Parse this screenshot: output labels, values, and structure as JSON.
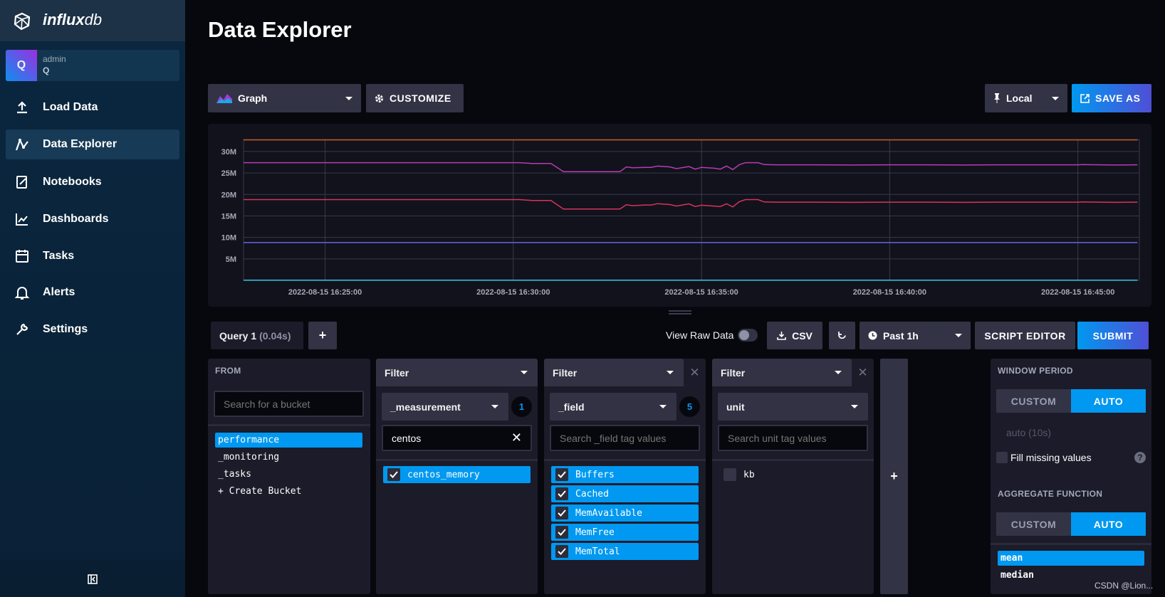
{
  "app": {
    "logo_main": "influx",
    "logo_sub": "db"
  },
  "user": {
    "avatar_letter": "Q",
    "role": "admin",
    "org": "Q"
  },
  "sidebar": {
    "items": [
      {
        "label": "Load Data",
        "icon": "upload-icon"
      },
      {
        "label": "Data Explorer",
        "icon": "graph-icon",
        "active": true
      },
      {
        "label": "Notebooks",
        "icon": "notebook-icon"
      },
      {
        "label": "Dashboards",
        "icon": "dashboard-icon"
      },
      {
        "label": "Tasks",
        "icon": "calendar-icon"
      },
      {
        "label": "Alerts",
        "icon": "bell-icon"
      },
      {
        "label": "Settings",
        "icon": "wrench-icon"
      }
    ]
  },
  "header": {
    "title": "Data Explorer"
  },
  "toolbar": {
    "vis_type": "Graph",
    "customize": "CUSTOMIZE",
    "time_zone": "Local",
    "save_as": "SAVE AS"
  },
  "query_bar": {
    "tab_label": "Query 1",
    "tab_time": "(0.04s)",
    "add": "+",
    "view_raw": "View Raw Data",
    "view_raw_on": false,
    "csv": "CSV",
    "time_range": "Past 1h",
    "script_editor": "SCRIPT EDITOR",
    "submit": "SUBMIT"
  },
  "from": {
    "label": "FROM",
    "search_placeholder": "Search for a bucket",
    "buckets": [
      "performance",
      "_monitoring",
      "_tasks"
    ],
    "selected": "performance",
    "create": "+ Create Bucket"
  },
  "filters": [
    {
      "header": "Filter",
      "key": "_measurement",
      "count": "1",
      "search_value": "centos",
      "search_placeholder": "",
      "values": [
        {
          "label": "centos_memory",
          "checked": true
        }
      ]
    },
    {
      "header": "Filter",
      "key": "_field",
      "count": "5",
      "search_value": "",
      "search_placeholder": "Search _field tag values",
      "values": [
        {
          "label": "Buffers",
          "checked": true
        },
        {
          "label": "Cached",
          "checked": true
        },
        {
          "label": "MemAvailable",
          "checked": true
        },
        {
          "label": "MemFree",
          "checked": true
        },
        {
          "label": "MemTotal",
          "checked": true
        }
      ]
    },
    {
      "header": "Filter",
      "key": "unit",
      "count": "",
      "search_value": "",
      "search_placeholder": "Search unit tag values",
      "values": [
        {
          "label": "kb",
          "checked": false
        }
      ]
    }
  ],
  "add_filter": "+",
  "aggregate": {
    "window_label": "WINDOW PERIOD",
    "custom": "CUSTOM",
    "auto": "AUTO",
    "window_selected": "AUTO",
    "window_value": "auto (10s)",
    "fill_missing": "Fill missing values",
    "fill_checked": false,
    "function_label": "AGGREGATE FUNCTION",
    "function_selected": "AUTO",
    "functions": [
      "mean",
      "median"
    ],
    "selected_function": "mean"
  },
  "watermark": "CSDN @Lion...",
  "chart_data": {
    "type": "line",
    "xlim": [
      "2022-08-15 16:22:50",
      "2022-08-15 16:46:38"
    ],
    "ylim": [
      0,
      32800000
    ],
    "x_ticks": [
      "2022-08-15 16:25:00",
      "2022-08-15 16:30:00",
      "2022-08-15 16:35:00",
      "2022-08-15 16:40:00",
      "2022-08-15 16:45:00"
    ],
    "y_ticks": [
      {
        "value": 5000000,
        "label": "5M"
      },
      {
        "value": 10000000,
        "label": "10M"
      },
      {
        "value": 15000000,
        "label": "15M"
      },
      {
        "value": 20000000,
        "label": "20M"
      },
      {
        "value": 25000000,
        "label": "25M"
      },
      {
        "value": 30000000,
        "label": "30M"
      }
    ],
    "grid": true,
    "x": [
      "16:22:50",
      "16:30:10",
      "16:30:30",
      "16:31:00",
      "16:31:20",
      "16:32:50",
      "16:33:00",
      "16:33:10",
      "16:33:30",
      "16:33:40",
      "16:33:50",
      "16:34:10",
      "16:34:20",
      "16:34:40",
      "16:34:50",
      "16:35:00",
      "16:35:20",
      "16:35:30",
      "16:35:40",
      "16:35:50",
      "16:36:00",
      "16:36:10",
      "16:36:30",
      "16:36:40",
      "16:37:00",
      "16:38:00",
      "16:39:00",
      "16:40:00",
      "16:41:00",
      "16:42:00",
      "16:43:00",
      "16:44:00",
      "16:45:00",
      "16:45:10",
      "16:46:00",
      "16:46:35"
    ],
    "series": [
      {
        "color": "#c4561c",
        "values": [
          32700000,
          32700000,
          32700000,
          32700000,
          32700000,
          32700000,
          32700000,
          32700000,
          32700000,
          32700000,
          32700000,
          32700000,
          32700000,
          32700000,
          32700000,
          32700000,
          32700000,
          32700000,
          32700000,
          32700000,
          32700000,
          32700000,
          32700000,
          32700000,
          32700000,
          32700000,
          32700000,
          32700000,
          32700000,
          32700000,
          32700000,
          32700000,
          32700000,
          32700000,
          32700000,
          32700000
        ]
      },
      {
        "color": "#b93bb5",
        "values": [
          27400000,
          27400000,
          27200000,
          27200000,
          25300000,
          25300000,
          26400000,
          26200000,
          26300000,
          26300000,
          26600000,
          26400000,
          26000000,
          26500000,
          25900000,
          26300000,
          26100000,
          25900000,
          26600000,
          25800000,
          26900000,
          27400000,
          27400000,
          26950000,
          26900000,
          26900000,
          26850000,
          26900000,
          26900000,
          26850000,
          26900000,
          26900000,
          26900000,
          26950000,
          26850000,
          26900000
        ]
      },
      {
        "color": "#d6345a",
        "values": [
          18800000,
          18800000,
          18600000,
          18600000,
          16600000,
          16600000,
          17600000,
          17400000,
          17550000,
          17550000,
          17850000,
          17650000,
          17300000,
          17800000,
          17200000,
          17500000,
          17300000,
          17200000,
          17800000,
          17100000,
          18300000,
          18800000,
          18800000,
          18250000,
          18200000,
          18200000,
          18150000,
          18200000,
          18200000,
          18150000,
          18200000,
          18200000,
          18200000,
          18250000,
          18150000,
          18200000
        ]
      },
      {
        "color": "#6764e0",
        "values": [
          8800000,
          8800000,
          8800000,
          8800000,
          8800000,
          8800000,
          8800000,
          8800000,
          8800000,
          8800000,
          8800000,
          8800000,
          8800000,
          8800000,
          8800000,
          8800000,
          8800000,
          8800000,
          8800000,
          8800000,
          8800000,
          8800000,
          8800000,
          8800000,
          8800000,
          8800000,
          8800000,
          8800000,
          8800000,
          8800000,
          8800000,
          8800000,
          8800000,
          8800000,
          8800000,
          8800000
        ]
      },
      {
        "color": "#3bc4e8",
        "values": [
          50000,
          50000,
          50000,
          50000,
          50000,
          50000,
          50000,
          50000,
          50000,
          50000,
          50000,
          50000,
          50000,
          50000,
          50000,
          50000,
          50000,
          50000,
          50000,
          50000,
          50000,
          50000,
          50000,
          50000,
          50000,
          50000,
          50000,
          50000,
          50000,
          50000,
          50000,
          50000,
          50000,
          50000,
          50000,
          50000
        ]
      }
    ]
  }
}
